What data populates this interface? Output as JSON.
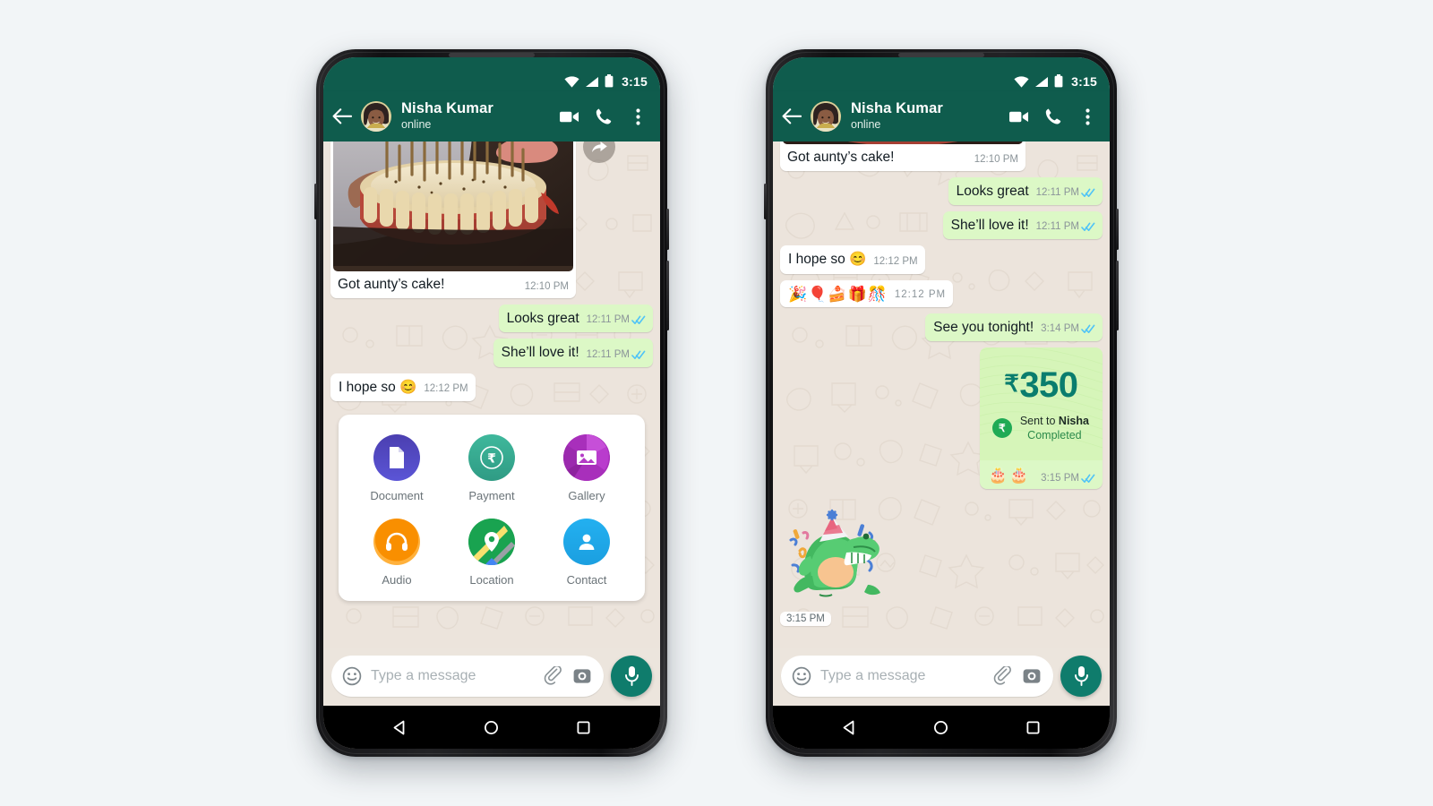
{
  "app": {
    "status_bar": {
      "time": "3:15",
      "icons": [
        "wifi-icon",
        "signal-icon",
        "battery-icon"
      ]
    },
    "header": {
      "back_icon": "arrow-left-icon",
      "contact_name": "Nisha Kumar",
      "presence": "online",
      "video_call_icon": "video-camera-icon",
      "voice_call_icon": "phone-icon",
      "overflow_icon": "more-vertical-icon"
    },
    "input_bar": {
      "emoji_icon": "smiley-icon",
      "placeholder": "Type a message",
      "attach_icon": "paperclip-icon",
      "camera_icon": "camera-icon",
      "mic_icon": "microphone-icon"
    },
    "nav_bar": {
      "back": "triangle-back-icon",
      "home": "circle-home-icon",
      "recents": "square-recents-icon"
    }
  },
  "left_phone": {
    "messages": [
      {
        "id": "photo-msg",
        "direction": "in",
        "type": "image",
        "image_alt": "hands holding a birthday cake with candles",
        "caption": "Got aunty’s cake!",
        "time": "12:10 PM",
        "forward_icon": "forward-arrow-icon"
      },
      {
        "id": "m2",
        "direction": "out",
        "type": "text",
        "text": "Looks great",
        "time": "12:11 PM",
        "status": "read"
      },
      {
        "id": "m3",
        "direction": "out",
        "type": "text",
        "text": "She’ll love it!",
        "time": "12:11 PM",
        "status": "read"
      },
      {
        "id": "m4",
        "direction": "in",
        "type": "text",
        "text": "I hope so 😊",
        "time": "12:12 PM"
      }
    ],
    "attachment_panel": {
      "items": [
        {
          "label": "Document",
          "icon": "document-icon",
          "color": "#4a4ab5"
        },
        {
          "label": "Payment",
          "icon": "rupee-coin-icon",
          "color": "#34a98d"
        },
        {
          "label": "Gallery",
          "icon": "photo-icon",
          "color": "#b43bc6"
        },
        {
          "label": "Audio",
          "icon": "headphones-icon",
          "color": "#f59300"
        },
        {
          "label": "Location",
          "icon": "map-pin-icon",
          "color": "#1ca14b"
        },
        {
          "label": "Contact",
          "icon": "person-icon",
          "color": "#1fa5e8"
        }
      ]
    }
  },
  "right_phone": {
    "messages": [
      {
        "id": "r1",
        "direction": "in",
        "type": "image-tail",
        "caption": "Got aunty’s cake!",
        "time": "12:10 PM"
      },
      {
        "id": "r2",
        "direction": "out",
        "type": "text",
        "text": "Looks great",
        "time": "12:11 PM",
        "status": "read"
      },
      {
        "id": "r3",
        "direction": "out",
        "type": "text",
        "text": "She’ll love it!",
        "time": "12:11 PM",
        "status": "read"
      },
      {
        "id": "r4",
        "direction": "in",
        "type": "text",
        "text": "I hope so 😊",
        "time": "12:12 PM"
      },
      {
        "id": "r5",
        "direction": "in",
        "type": "emoji",
        "text": "🎉🎈🍰🎁🎊",
        "time": "12:12 PM"
      },
      {
        "id": "r6",
        "direction": "out",
        "type": "text",
        "text": "See you tonight!",
        "time": "3:14 PM",
        "status": "read"
      }
    ],
    "payment": {
      "currency_symbol": "₹",
      "amount": "350",
      "badge_symbol": "₹",
      "sent_to_prefix": "Sent to ",
      "recipient": "Nisha",
      "status": "Completed",
      "emojis": "🎂🎂",
      "time": "3:15 PM",
      "tick_status": "read",
      "accent_color": "#0a7d6e",
      "card_color": "#d6f5b9"
    },
    "sticker": {
      "name": "party-dinosaur-sticker",
      "description": "green dinosaur wearing a party hat with confetti",
      "time": "3:15 PM"
    }
  }
}
